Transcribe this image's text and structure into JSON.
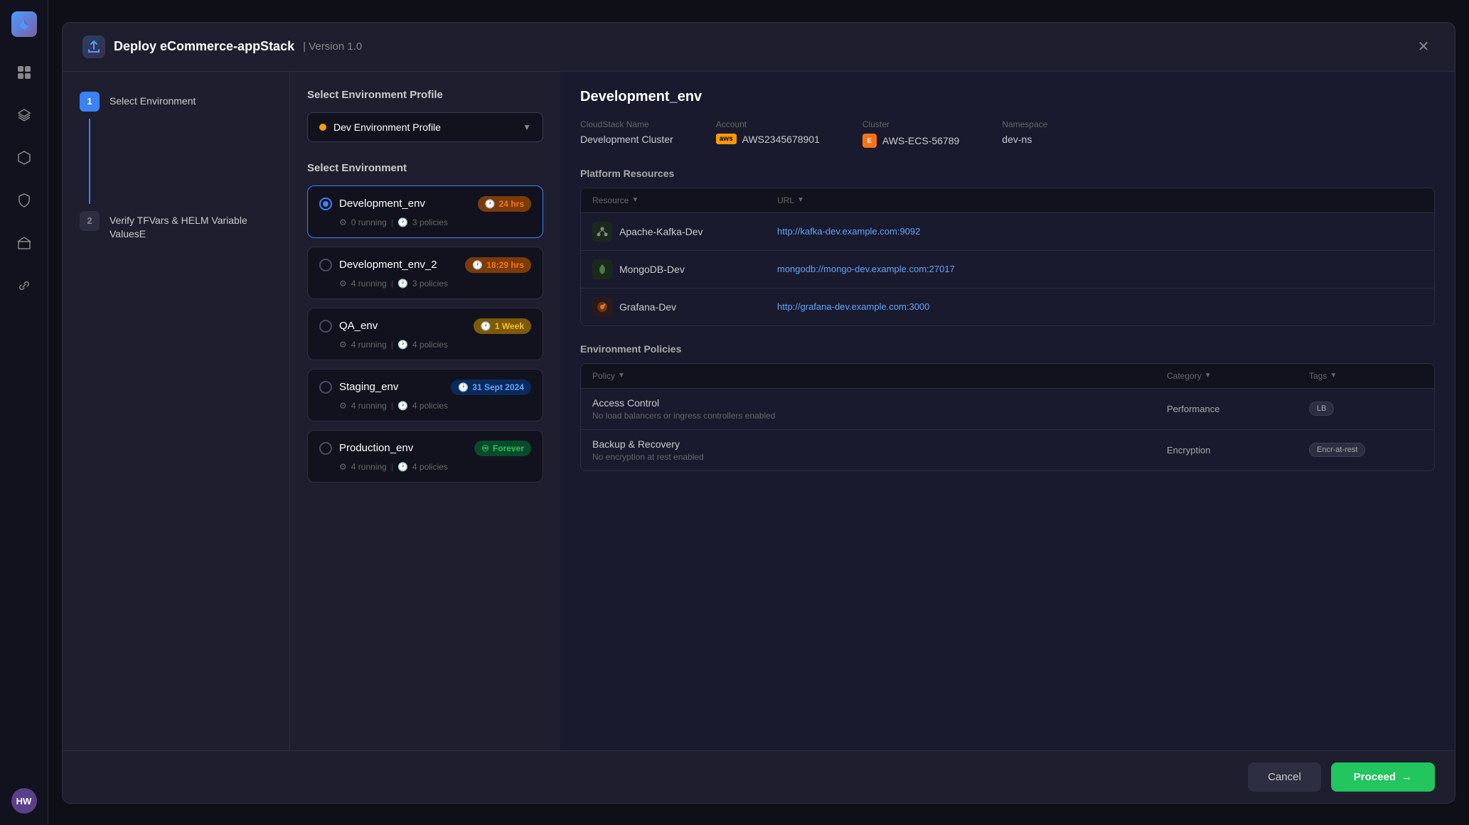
{
  "app": {
    "title": "Deploy eCommerce-appStack",
    "version": "Version 1.0",
    "logo": "☁️"
  },
  "sidebar": {
    "avatar": "HW",
    "icons": [
      "⊞",
      "≡",
      "⬡",
      "⛉",
      "⛏",
      "⇌"
    ]
  },
  "steps": [
    {
      "number": "1",
      "label": "Select Environment",
      "active": true
    },
    {
      "number": "2",
      "label": "Verify TFVars & HELM  Variable ValuesE",
      "active": false
    }
  ],
  "content": {
    "profile_section_title": "Select Environment Profile",
    "selected_profile": "Dev Environment Profile",
    "env_section_title": "Select Environment",
    "environments": [
      {
        "name": "Development_env",
        "running": "0 running",
        "policies": "3 policies",
        "badge_text": "24 hrs",
        "badge_type": "orange",
        "selected": true
      },
      {
        "name": "Development_env_2",
        "running": "4 running",
        "policies": "3 policies",
        "badge_text": "18:29 hrs",
        "badge_type": "orange",
        "selected": false
      },
      {
        "name": "QA_env",
        "running": "4 running",
        "policies": "4 policies",
        "badge_text": "1 Week",
        "badge_type": "amber",
        "selected": false
      },
      {
        "name": "Staging_env",
        "running": "4 running",
        "policies": "4 policies",
        "badge_text": "31 Sept 2024",
        "badge_type": "blue",
        "selected": false
      },
      {
        "name": "Production_env",
        "running": "4 running",
        "policies": "4 policies",
        "badge_text": "Forever",
        "badge_type": "green",
        "selected": false
      }
    ],
    "detail": {
      "env_name": "Development_env",
      "cloudstack_name_label": "CloudStack Name",
      "cloudstack_name_value": "Development Cluster",
      "account_label": "Account",
      "account_value": "AWS2345678901",
      "cluster_label": "Cluster",
      "cluster_value": "AWS-ECS-56789",
      "namespace_label": "Namespace",
      "namespace_value": "dev-ns",
      "platform_resources_title": "Platform Resources",
      "resource_col": "Resource",
      "url_col": "URL",
      "resources": [
        {
          "icon": "⚡",
          "icon_class": "icon-kafka",
          "name": "Apache-Kafka-Dev",
          "url": "http://kafka-dev.example.com:9092"
        },
        {
          "icon": "🍃",
          "icon_class": "icon-mongo",
          "name": "MongoDB-Dev",
          "url": "mongodb://mongo-dev.example.com:27017"
        },
        {
          "icon": "📊",
          "icon_class": "icon-grafana",
          "name": "Grafana-Dev",
          "url": "http://grafana-dev.example.com:3000"
        }
      ],
      "env_policies_title": "Environment Policies",
      "policy_col": "Policy",
      "category_col": "Category",
      "tags_col": "Tags",
      "policies": [
        {
          "name": "Access Control",
          "desc": "No load balancers or ingress controllers enabled",
          "category": "Performance",
          "tag": "LB"
        },
        {
          "name": "Backup & Recovery",
          "desc": "No encryption at rest enabled",
          "category": "Encryption",
          "tag": "Encr-at-rest"
        }
      ]
    }
  },
  "footer": {
    "cancel_label": "Cancel",
    "proceed_label": "Proceed"
  }
}
